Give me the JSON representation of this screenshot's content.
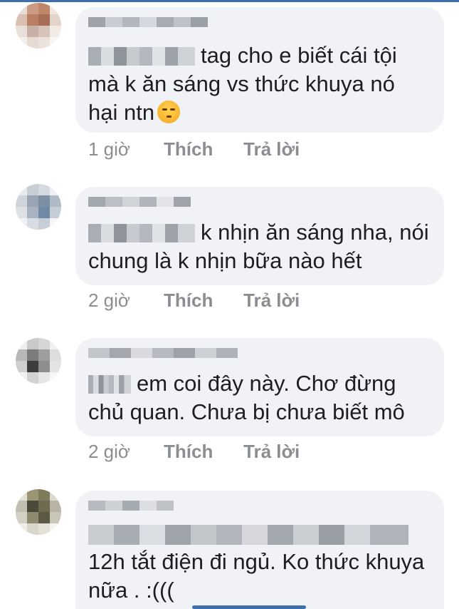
{
  "actions": {
    "like_label": "Thích",
    "reply_label": "Trả lời"
  },
  "comments": [
    {
      "text": "tag cho e biết cái tội\nmà k ăn sáng vs thức khuya nó\nhại ntn",
      "emoji": "unamused-face-emoji",
      "time": "1 giờ"
    },
    {
      "text": "k nhịn ăn sáng nha, nói\nchung là k nhịn bữa nào hết",
      "time": "2 giờ"
    },
    {
      "text": "em coi đây này. Chơ đừng\nchủ quan. Chưa bị chưa biết mô",
      "time": "2 giờ"
    },
    {
      "text": "12h tắt điện đi ngủ. Ko thức khuya\nnữa . :(((",
      "time": ""
    }
  ]
}
